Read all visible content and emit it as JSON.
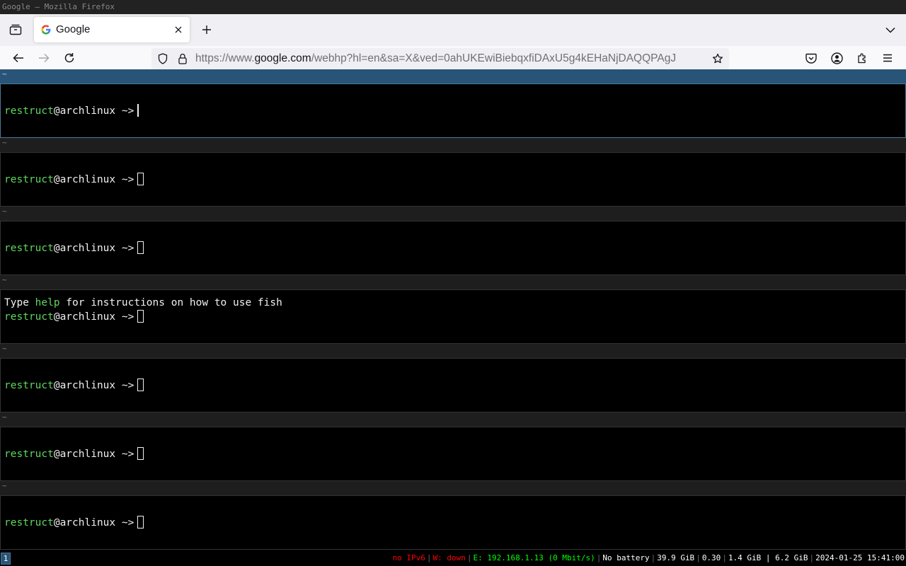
{
  "window_title": "Google — Mozilla Firefox",
  "browser": {
    "tab_title": "Google",
    "url_prefix": "https://www.",
    "url_host": "google.com",
    "url_rest": "/webhp?hl=en&sa=X&ved=0ahUKEwiBiebqxfiDAxU5g4kEHaNjDAQQPAgJ"
  },
  "terminals": [
    {
      "header": "~",
      "user": "restruct",
      "host": "@archlinux",
      "prompt": " ~>"
    },
    {
      "header": "~",
      "user": "restruct",
      "host": "@archlinux",
      "prompt": " ~>"
    },
    {
      "header": "~",
      "user": "restruct",
      "host": "@archlinux",
      "prompt": " ~>"
    },
    {
      "header": "~",
      "user": "restruct",
      "host": "@archlinux",
      "prompt": " ~>",
      "greeting_pre": "Type ",
      "greeting_cmd": "help",
      "greeting_post": " for instructions on how to use fish"
    },
    {
      "header": "~",
      "user": "restruct",
      "host": "@archlinux",
      "prompt": " ~>"
    },
    {
      "header": "~",
      "user": "restruct",
      "host": "@archlinux",
      "prompt": " ~>"
    },
    {
      "header": "~",
      "user": "restruct",
      "host": "@archlinux",
      "prompt": " ~>"
    }
  ],
  "statusbar": {
    "workspace": "1",
    "ipv6": "no IPv6",
    "wireless": "W: down",
    "ethernet": "E: 192.168.1.13 (0 Mbit/s)",
    "battery": "No battery",
    "disk": "39.9 GiB",
    "load": "0.30",
    "memory": "1.4 GiB | 6.2 GiB",
    "datetime": "2024-01-25 15:41:00"
  },
  "colors": {
    "prompt_user": "#5fd75f",
    "error": "#ff0000",
    "ok": "#00ff00",
    "focused_border": "#4c7899"
  }
}
